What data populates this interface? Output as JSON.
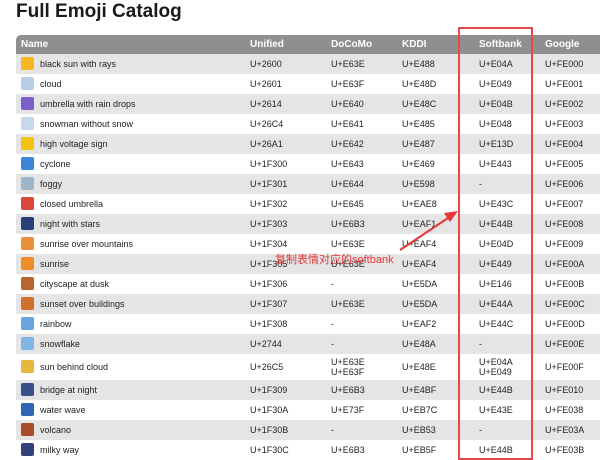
{
  "page": {
    "title": "Full Emoji Catalog"
  },
  "table": {
    "columns": [
      "Name",
      "Unified",
      "DoCoMo",
      "KDDI",
      "Softbank",
      "Google"
    ],
    "rows": [
      {
        "name": "black sun with rays",
        "icon": "sun-icon",
        "unified": "U+2600",
        "docomo": "U+E63E",
        "kddi": "U+E488",
        "softbank": "U+E04A",
        "google": "U+FE000"
      },
      {
        "name": "cloud",
        "icon": "cloud-icon",
        "unified": "U+2601",
        "docomo": "U+E63F",
        "kddi": "U+E48D",
        "softbank": "U+E049",
        "google": "U+FE001"
      },
      {
        "name": "umbrella with rain drops",
        "icon": "umbrella-rain-icon",
        "unified": "U+2614",
        "docomo": "U+E640",
        "kddi": "U+E48C",
        "softbank": "U+E04B",
        "google": "U+FE002"
      },
      {
        "name": "snowman without snow",
        "icon": "snowman-icon",
        "unified": "U+26C4",
        "docomo": "U+E641",
        "kddi": "U+E485",
        "softbank": "U+E048",
        "google": "U+FE003"
      },
      {
        "name": "high voltage sign",
        "icon": "lightning-icon",
        "unified": "U+26A1",
        "docomo": "U+E642",
        "kddi": "U+E487",
        "softbank": "U+E13D",
        "google": "U+FE004"
      },
      {
        "name": "cyclone",
        "icon": "cyclone-icon",
        "unified": "U+1F300",
        "docomo": "U+E643",
        "kddi": "U+E469",
        "softbank": "U+E443",
        "google": "U+FE005"
      },
      {
        "name": "foggy",
        "icon": "fog-icon",
        "unified": "U+1F301",
        "docomo": "U+E644",
        "kddi": "U+E598",
        "softbank": "-",
        "google": "U+FE006"
      },
      {
        "name": "closed umbrella",
        "icon": "closed-umbrella-icon",
        "unified": "U+1F302",
        "docomo": "U+E645",
        "kddi": "U+EAE8",
        "softbank": "U+E43C",
        "google": "U+FE007"
      },
      {
        "name": "night with stars",
        "icon": "night-stars-icon",
        "unified": "U+1F303",
        "docomo": "U+E6B3",
        "kddi": "U+EAF1",
        "softbank": "U+E44B",
        "google": "U+FE008"
      },
      {
        "name": "sunrise over mountains",
        "icon": "sunrise-mountains-icon",
        "unified": "U+1F304",
        "docomo": "U+E63E",
        "kddi": "U+EAF4",
        "softbank": "U+E04D",
        "google": "U+FE009"
      },
      {
        "name": "sunrise",
        "icon": "sunrise-icon",
        "unified": "U+1F305",
        "docomo": "U+E63E",
        "kddi": "U+EAF4",
        "softbank": "U+E449",
        "google": "U+FE00A"
      },
      {
        "name": "cityscape at dusk",
        "icon": "cityscape-icon",
        "unified": "U+1F306",
        "docomo": "-",
        "kddi": "U+E5DA",
        "softbank": "U+E146",
        "google": "U+FE00B"
      },
      {
        "name": "sunset over buildings",
        "icon": "sunset-buildings-icon",
        "unified": "U+1F307",
        "docomo": "U+E63E",
        "kddi": "U+E5DA",
        "softbank": "U+E44A",
        "google": "U+FE00C"
      },
      {
        "name": "rainbow",
        "icon": "rainbow-icon",
        "unified": "U+1F308",
        "docomo": "-",
        "kddi": "U+EAF2",
        "softbank": "U+E44C",
        "google": "U+FE00D"
      },
      {
        "name": "snowflake",
        "icon": "snowflake-icon",
        "unified": "U+2744",
        "docomo": "-",
        "kddi": "U+E48A",
        "softbank": "-",
        "google": "U+FE00E"
      },
      {
        "name": "sun behind cloud",
        "icon": "sun-cloud-icon",
        "unified": "U+26C5",
        "docomo": "U+E63E\nU+E63F",
        "kddi": "U+E48E",
        "softbank": "U+E04A\nU+E049",
        "google": "U+FE00F"
      },
      {
        "name": "bridge at night",
        "icon": "bridge-night-icon",
        "unified": "U+1F309",
        "docomo": "U+E6B3",
        "kddi": "U+E4BF",
        "softbank": "U+E44B",
        "google": "U+FE010"
      },
      {
        "name": "water wave",
        "icon": "wave-icon",
        "unified": "U+1F30A",
        "docomo": "U+E73F",
        "kddi": "U+EB7C",
        "softbank": "U+E43E",
        "google": "U+FE038"
      },
      {
        "name": "volcano",
        "icon": "volcano-icon",
        "unified": "U+1F30B",
        "docomo": "-",
        "kddi": "U+EB53",
        "softbank": "-",
        "google": "U+FE03A"
      },
      {
        "name": "milky way",
        "icon": "milky-way-icon",
        "unified": "U+1F30C",
        "docomo": "U+E6B3",
        "kddi": "U+EB5F",
        "softbank": "U+E44B",
        "google": "U+FE03B"
      }
    ]
  },
  "annotation": {
    "text": "复制表情对应的softbank",
    "color": "#e23838"
  },
  "icon_colors": {
    "sun-icon": "#f5b820",
    "cloud-icon": "#b9cde6",
    "umbrella-rain-icon": "#7b5fc8",
    "snowman-icon": "#c8d8ec",
    "lightning-icon": "#f2c40f",
    "cyclone-icon": "#3b86d6",
    "fog-icon": "#9fb5c8",
    "closed-umbrella-icon": "#d8463c",
    "night-stars-icon": "#2a3f7a",
    "sunrise-mountains-icon": "#e8913a",
    "sunrise-icon": "#f08c2c",
    "cityscape-icon": "#b8662e",
    "sunset-buildings-icon": "#d0702c",
    "rainbow-icon": "#6aa6de",
    "snowflake-icon": "#7fb6e6",
    "sun-cloud-icon": "#e4b83c",
    "bridge-night-icon": "#3a4f88",
    "wave-icon": "#2c66b4",
    "volcano-icon": "#a84c2c",
    "milky-way-icon": "#34407a"
  }
}
